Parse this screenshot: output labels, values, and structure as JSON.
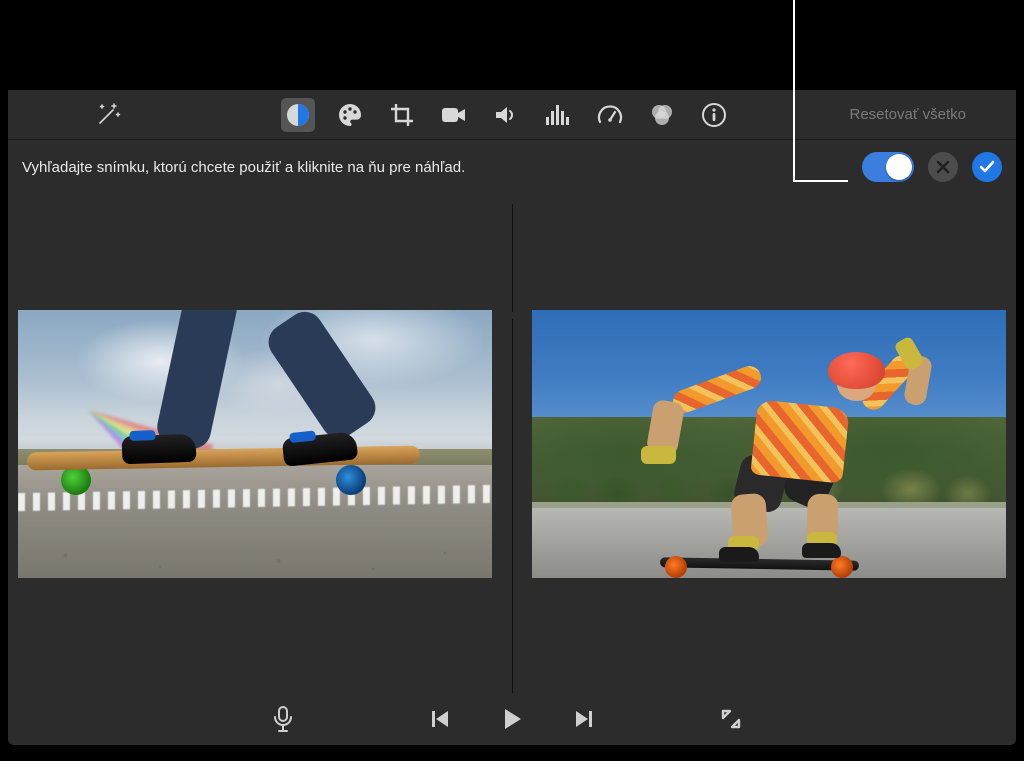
{
  "toolbar": {
    "reset_label": "Resetovať všetko"
  },
  "hint": {
    "text": "Vyhľadajte snímku, ktorú chcete použiť a kliknite na ňu pre náhľad."
  },
  "colors": {
    "accent": "#1f78e5",
    "toggle_on": "#3b7ee0"
  },
  "controls": {
    "match_toggle_on": true
  },
  "icons": {
    "magic": "magic-wand",
    "balance": "color-balance",
    "palette": "color-palette",
    "crop": "crop",
    "stabilize": "video-camera",
    "volume": "speaker",
    "eq": "equalizer",
    "speed": "speedometer",
    "filters": "overlap-circles",
    "info": "info"
  }
}
